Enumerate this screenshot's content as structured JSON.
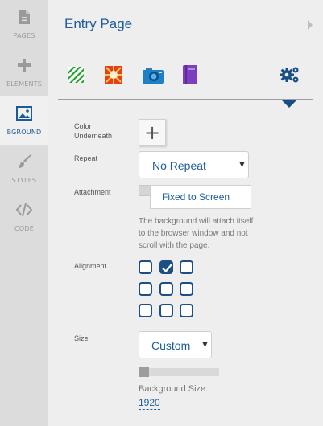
{
  "sidebar": {
    "items": [
      {
        "label": "PAGES",
        "icon": "page-icon"
      },
      {
        "label": "ELEMENTS",
        "icon": "plus-icon"
      },
      {
        "label": "BGROUND",
        "icon": "image-icon"
      },
      {
        "label": "STYLES",
        "icon": "brush-icon"
      },
      {
        "label": "CODE",
        "icon": "code-icon"
      }
    ],
    "active": "BGROUND"
  },
  "header": {
    "title": "Entry Page"
  },
  "toolbar": {
    "tools": [
      "stripes-pattern-icon",
      "sunburst-image-icon",
      "camera-icon",
      "book-icon",
      "gears-icon"
    ]
  },
  "settings": {
    "color_underneath_label": "Color Underneath",
    "repeat_label": "Repeat",
    "repeat_value": "No Repeat",
    "attachment_label": "Attachment",
    "attachment_value": "Fixed to Screen",
    "attachment_help": "The background will attach itself to the browser window and not scroll with the page.",
    "alignment_label": "Alignment",
    "alignment_selected": "top-center",
    "size_label": "Size",
    "size_value": "Custom",
    "background_size_label": "Background Size:",
    "background_size_value": "1920"
  },
  "colors": {
    "accent": "#1e5c99",
    "dark_accent": "#1d4f84"
  }
}
